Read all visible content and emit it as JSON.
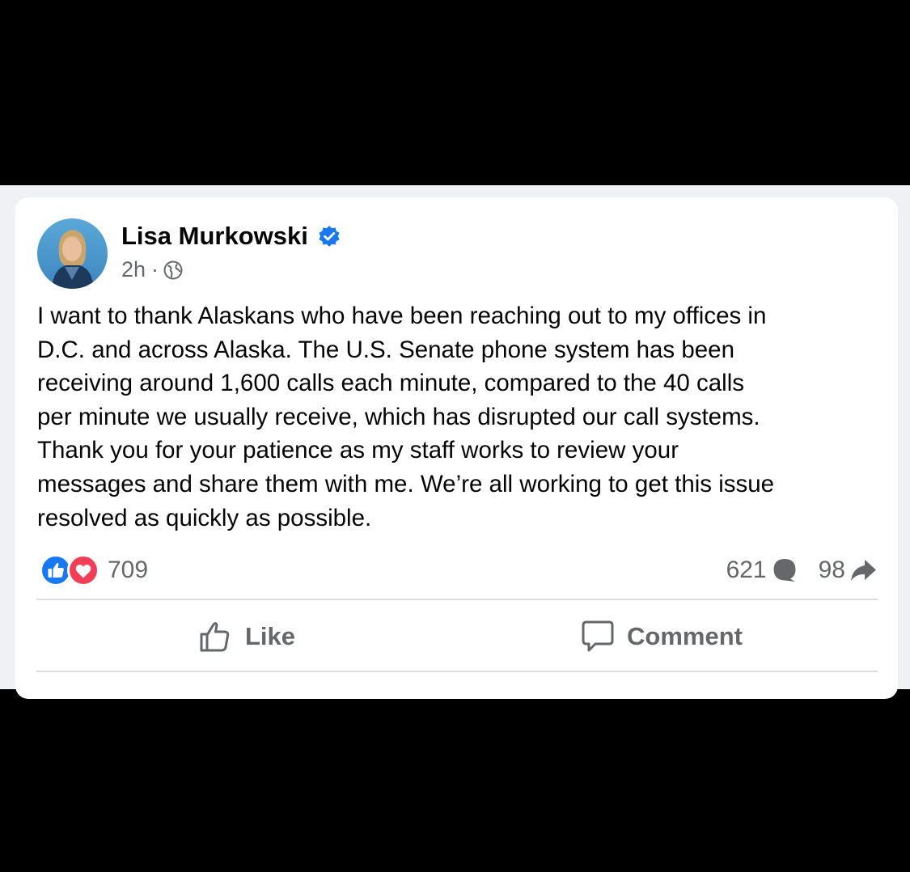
{
  "post": {
    "author": "Lisa Murkowski",
    "verified_icon": "verified-badge-icon",
    "time": "2h",
    "separator": "·",
    "audience_icon": "globe-icon",
    "text_lines": [
      "I want to thank Alaskans who have been reaching out to my offices in",
      "D.C. and across Alaska. The U.S. Senate phone system has been",
      "receiving around 1,600 calls each minute, compared to the 40 calls",
      "per minute we usually receive, which has disrupted our call systems.",
      "Thank you for your patience as my staff works to review your",
      "messages and share them with me. We’re all working to get this issue",
      "resolved as quickly as possible."
    ]
  },
  "engagement": {
    "reaction_count": "709",
    "reaction_icons": [
      "like-reaction-icon",
      "love-reaction-icon"
    ],
    "comment_count": "621",
    "share_count": "98"
  },
  "actions": {
    "like_label": "Like",
    "comment_label": "Comment"
  },
  "colors": {
    "brand_blue": "#1877f2",
    "love_red": "#f33e58",
    "secondary_text": "#65676b",
    "primary_text": "#050505"
  }
}
